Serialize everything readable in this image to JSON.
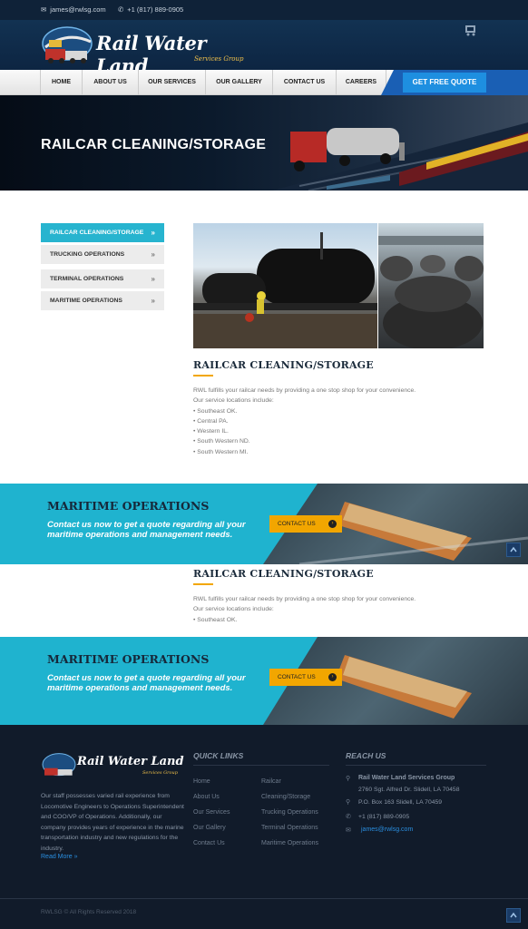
{
  "topbar": {
    "email": "james@rwlsg.com",
    "phone": "+1 (817) 889-0905"
  },
  "brand": {
    "name": "Rail Water Land",
    "tagline": "Services Group"
  },
  "nav": {
    "items": [
      "HOME",
      "ABOUT US",
      "OUR SERVICES",
      "OUR GALLERY",
      "CONTACT US",
      "CAREERS"
    ],
    "cta": "GET FREE QUOTE"
  },
  "hero": {
    "title": "RAILCAR CLEANING/STORAGE"
  },
  "sidebar": {
    "items": [
      "RAILCAR CLEANING/STORAGE",
      "TRUCKING OPERATIONS",
      "TERMINAL OPERATIONS",
      "MARITIME OPERATIONS"
    ],
    "active_index": 0
  },
  "content": {
    "heading": "RAILCAR CLEANING/STORAGE",
    "intro": "RWL fulfills your railcar needs by providing a one stop shop for your convenience.",
    "locations_label": "Our service locations include:",
    "locations": [
      "• Southeast OK.",
      "• Central PA.",
      "• Western IL.",
      "• South Western ND.",
      "• South Western MI."
    ]
  },
  "content_repeat": {
    "heading": "RAILCAR CLEANING/STORAGE",
    "intro": "RWL fulfills your railcar needs by providing a one stop shop for your convenience.",
    "locations_label": "Our service locations include:",
    "locations": [
      "• Southeast OK."
    ]
  },
  "banner": {
    "title": "MARITIME OPERATIONS",
    "text": "Contact us now to get a quote regarding all your maritime operations and management needs.",
    "button": "CONTACT US"
  },
  "footer": {
    "about": "Our staff possesses varied rail experience from Locomotive Engineers to Operations Superintendent and COO/VP of Operations. Additionally, our company provides years of experience in the marine transportation industry and new regulations for the industry.",
    "read_more": "Read More »",
    "quick_links_title": "QUICK LINKS",
    "links_col1": [
      "Home",
      "About Us",
      "Our Services",
      "Our Gallery",
      "Contact Us"
    ],
    "links_col2": [
      "Railcar",
      "Cleaning/Storage",
      "Trucking Operations",
      "Terminal Operations",
      "Maritime Operations"
    ],
    "reach_title": "REACH US",
    "company": "Rail Water Land Services Group",
    "address": "2760 Sgt. Alfred Dr. Slidell, LA 70458",
    "pobox": "P.O. Box 163 Slidell, LA 70459",
    "phone": "+1 (817) 889-0905",
    "email": "james@rwlsg.com",
    "copyright": "RWLSG © All Rights Reserved 2018"
  },
  "colors": {
    "accent": "#27b4cf",
    "orange": "#f2a600",
    "navy": "#0f2238",
    "cta": "#1e8fe0"
  },
  "icons": [
    "email-icon",
    "phone-icon",
    "cart-icon",
    "chevron-right-icon",
    "arrow-up-icon",
    "map-marker-icon",
    "envelope-icon"
  ]
}
